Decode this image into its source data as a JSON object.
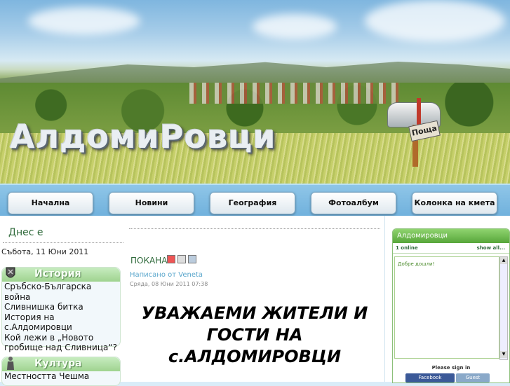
{
  "site": {
    "title": "АлдомиРовци",
    "mailbox_sign": "Поща"
  },
  "nav": [
    "Начална",
    "Новини",
    "География",
    "Фотоалбум",
    "Колонка на кмета"
  ],
  "left": {
    "today_heading": "Днес е",
    "today_date": "Събота, 11 Юни 2011",
    "sections": [
      {
        "title": "История",
        "items": [
          "Сръбско-Българска война",
          "Сливнишка битка",
          "История на с.Алдомировци",
          "Кой лежи в „Новото гробище над Сливница“?"
        ]
      },
      {
        "title": "Култура",
        "items": [
          "Местността Чешма"
        ]
      }
    ]
  },
  "article": {
    "title": "ПОКАНА",
    "author": "Написано от Veneta",
    "date": "Сряда, 08 Юни 2011 07:38",
    "headline": "УВАЖАЕМИ ЖИТЕЛИ И ГОСТИ НА с.АЛДОМИРОВЦИ"
  },
  "chat": {
    "title": "Алдомировци",
    "online": "1 online",
    "show_all": "show all...",
    "welcome": "Добре дошли!",
    "sign_in": "Please sign in",
    "facebook": "Facebook",
    "guest": "Guest"
  }
}
